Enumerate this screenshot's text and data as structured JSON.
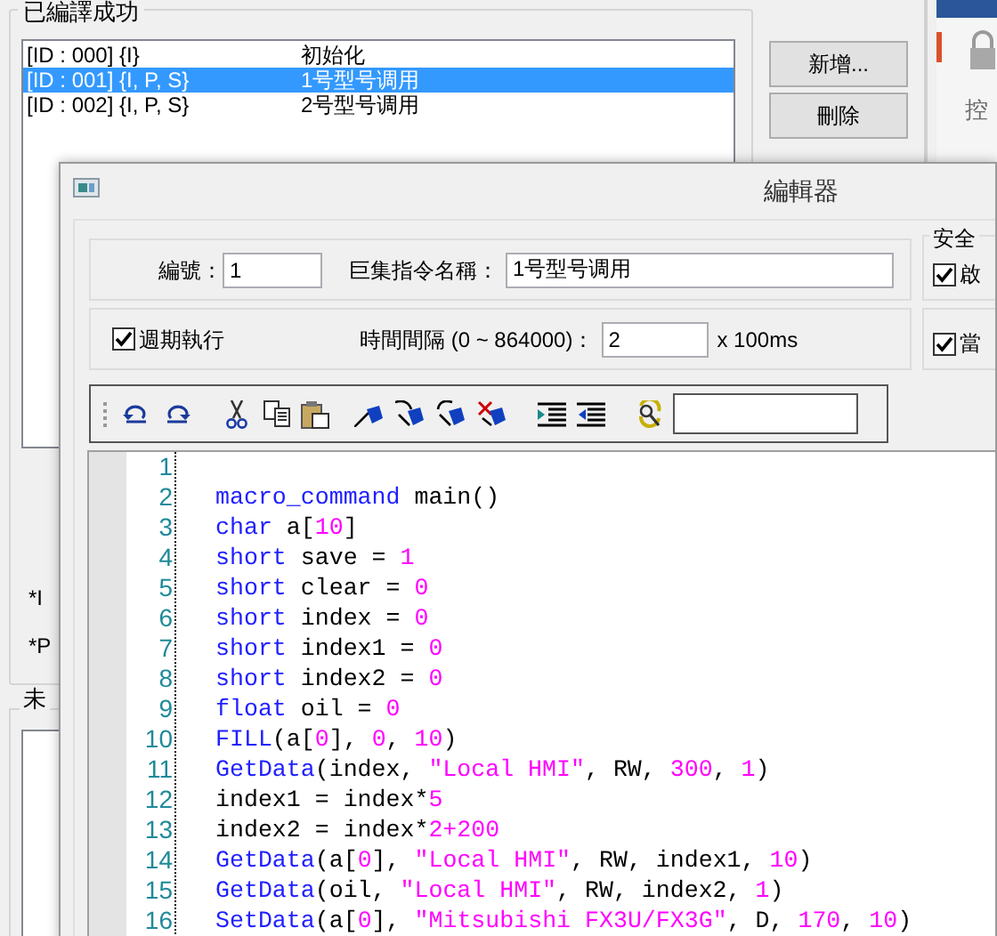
{
  "background_window": {
    "group_title": "已編譯成功",
    "macros": [
      {
        "id": "[ID : 000] {I}",
        "name": "初始化",
        "selected": false
      },
      {
        "id": "[ID : 001] {I, P, S}",
        "name": "1号型号调用",
        "selected": true
      },
      {
        "id": "[ID : 002] {I, P, S}",
        "name": "2号型号调用",
        "selected": false
      }
    ],
    "buttons": [
      "新增...",
      "刪除"
    ],
    "notes": [
      "*I",
      "*P"
    ],
    "group2_title": "未",
    "side_panel": {
      "label": "控"
    }
  },
  "editor": {
    "title": "編輯器",
    "number_label": "編號：",
    "number_value": "1",
    "name_label": "巨集指令名稱：",
    "name_value": "1号型号调用",
    "periodic": {
      "label": "週期執行",
      "checked": true
    },
    "interval_label": "時間間隔 (0 ~ 864000)：",
    "interval_value": "2",
    "interval_unit": "x 100ms",
    "security": {
      "title": "安全",
      "options": [
        {
          "label": "啟",
          "checked": true
        },
        {
          "label": "當",
          "checked": true
        }
      ]
    },
    "code": [
      {
        "number": "1"
      },
      {
        "number": "2",
        "segments": [
          {
            "kind": "keyword",
            "text": "macro_command"
          },
          {
            "kind": "plain",
            "text": " main()"
          }
        ]
      },
      {
        "number": "3",
        "segments": [
          {
            "kind": "keyword",
            "text": "char"
          },
          {
            "kind": "plain",
            "text": " a["
          },
          {
            "kind": "number",
            "text": "10"
          },
          {
            "kind": "plain",
            "text": "]"
          }
        ]
      },
      {
        "number": "4",
        "segments": [
          {
            "kind": "keyword",
            "text": "short"
          },
          {
            "kind": "plain",
            "text": " save = "
          },
          {
            "kind": "number",
            "text": "1"
          }
        ]
      },
      {
        "number": "5",
        "segments": [
          {
            "kind": "keyword",
            "text": "short"
          },
          {
            "kind": "plain",
            "text": " clear = "
          },
          {
            "kind": "number",
            "text": "0"
          }
        ]
      },
      {
        "number": "6",
        "segments": [
          {
            "kind": "keyword",
            "text": "short"
          },
          {
            "kind": "plain",
            "text": " index = "
          },
          {
            "kind": "number",
            "text": "0"
          }
        ]
      },
      {
        "number": "7",
        "segments": [
          {
            "kind": "keyword",
            "text": "short"
          },
          {
            "kind": "plain",
            "text": " index1 = "
          },
          {
            "kind": "number",
            "text": "0"
          }
        ]
      },
      {
        "number": "8",
        "segments": [
          {
            "kind": "keyword",
            "text": "short"
          },
          {
            "kind": "plain",
            "text": " index2 = "
          },
          {
            "kind": "number",
            "text": "0"
          }
        ]
      },
      {
        "number": "9",
        "segments": [
          {
            "kind": "keyword",
            "text": "float"
          },
          {
            "kind": "plain",
            "text": " oil = "
          },
          {
            "kind": "number",
            "text": "0"
          }
        ]
      },
      {
        "number": "10",
        "segments": [
          {
            "kind": "keyword",
            "text": "FILL"
          },
          {
            "kind": "plain",
            "text": "(a["
          },
          {
            "kind": "number",
            "text": "0"
          },
          {
            "kind": "plain",
            "text": "], "
          },
          {
            "kind": "number",
            "text": "0"
          },
          {
            "kind": "plain",
            "text": ", "
          },
          {
            "kind": "number",
            "text": "10"
          },
          {
            "kind": "plain",
            "text": ")"
          }
        ]
      },
      {
        "number": "11",
        "segments": [
          {
            "kind": "keyword",
            "text": "GetData"
          },
          {
            "kind": "plain",
            "text": "(index, "
          },
          {
            "kind": "string",
            "text": "\"Local HMI\""
          },
          {
            "kind": "plain",
            "text": ", RW, "
          },
          {
            "kind": "number",
            "text": "300"
          },
          {
            "kind": "plain",
            "text": ", "
          },
          {
            "kind": "number",
            "text": "1"
          },
          {
            "kind": "plain",
            "text": ")"
          }
        ]
      },
      {
        "number": "12",
        "segments": [
          {
            "kind": "plain",
            "text": "index1 = index*"
          },
          {
            "kind": "number",
            "text": "5"
          }
        ]
      },
      {
        "number": "13",
        "segments": [
          {
            "kind": "plain",
            "text": "index2 = index*"
          },
          {
            "kind": "number",
            "text": "2+200"
          }
        ]
      },
      {
        "number": "14",
        "segments": [
          {
            "kind": "keyword",
            "text": "GetData"
          },
          {
            "kind": "plain",
            "text": "(a["
          },
          {
            "kind": "number",
            "text": "0"
          },
          {
            "kind": "plain",
            "text": "], "
          },
          {
            "kind": "string",
            "text": "\"Local HMI\""
          },
          {
            "kind": "plain",
            "text": ", RW, index1, "
          },
          {
            "kind": "number",
            "text": "10"
          },
          {
            "kind": "plain",
            "text": ")"
          }
        ]
      },
      {
        "number": "15",
        "segments": [
          {
            "kind": "keyword",
            "text": "GetData"
          },
          {
            "kind": "plain",
            "text": "(oil, "
          },
          {
            "kind": "string",
            "text": "\"Local HMI\""
          },
          {
            "kind": "plain",
            "text": ", RW, index2, "
          },
          {
            "kind": "number",
            "text": "1"
          },
          {
            "kind": "plain",
            "text": ")"
          }
        ]
      },
      {
        "number": "16",
        "segments": [
          {
            "kind": "keyword",
            "text": "SetData"
          },
          {
            "kind": "plain",
            "text": "(a["
          },
          {
            "kind": "number",
            "text": "0"
          },
          {
            "kind": "plain",
            "text": "], "
          },
          {
            "kind": "string",
            "text": "\"Mitsubishi FX3U/FX3G\""
          },
          {
            "kind": "plain",
            "text": ", D, "
          },
          {
            "kind": "number",
            "text": "170"
          },
          {
            "kind": "plain",
            "text": ", "
          },
          {
            "kind": "number",
            "text": "10"
          },
          {
            "kind": "plain",
            "text": ")"
          }
        ]
      }
    ]
  }
}
